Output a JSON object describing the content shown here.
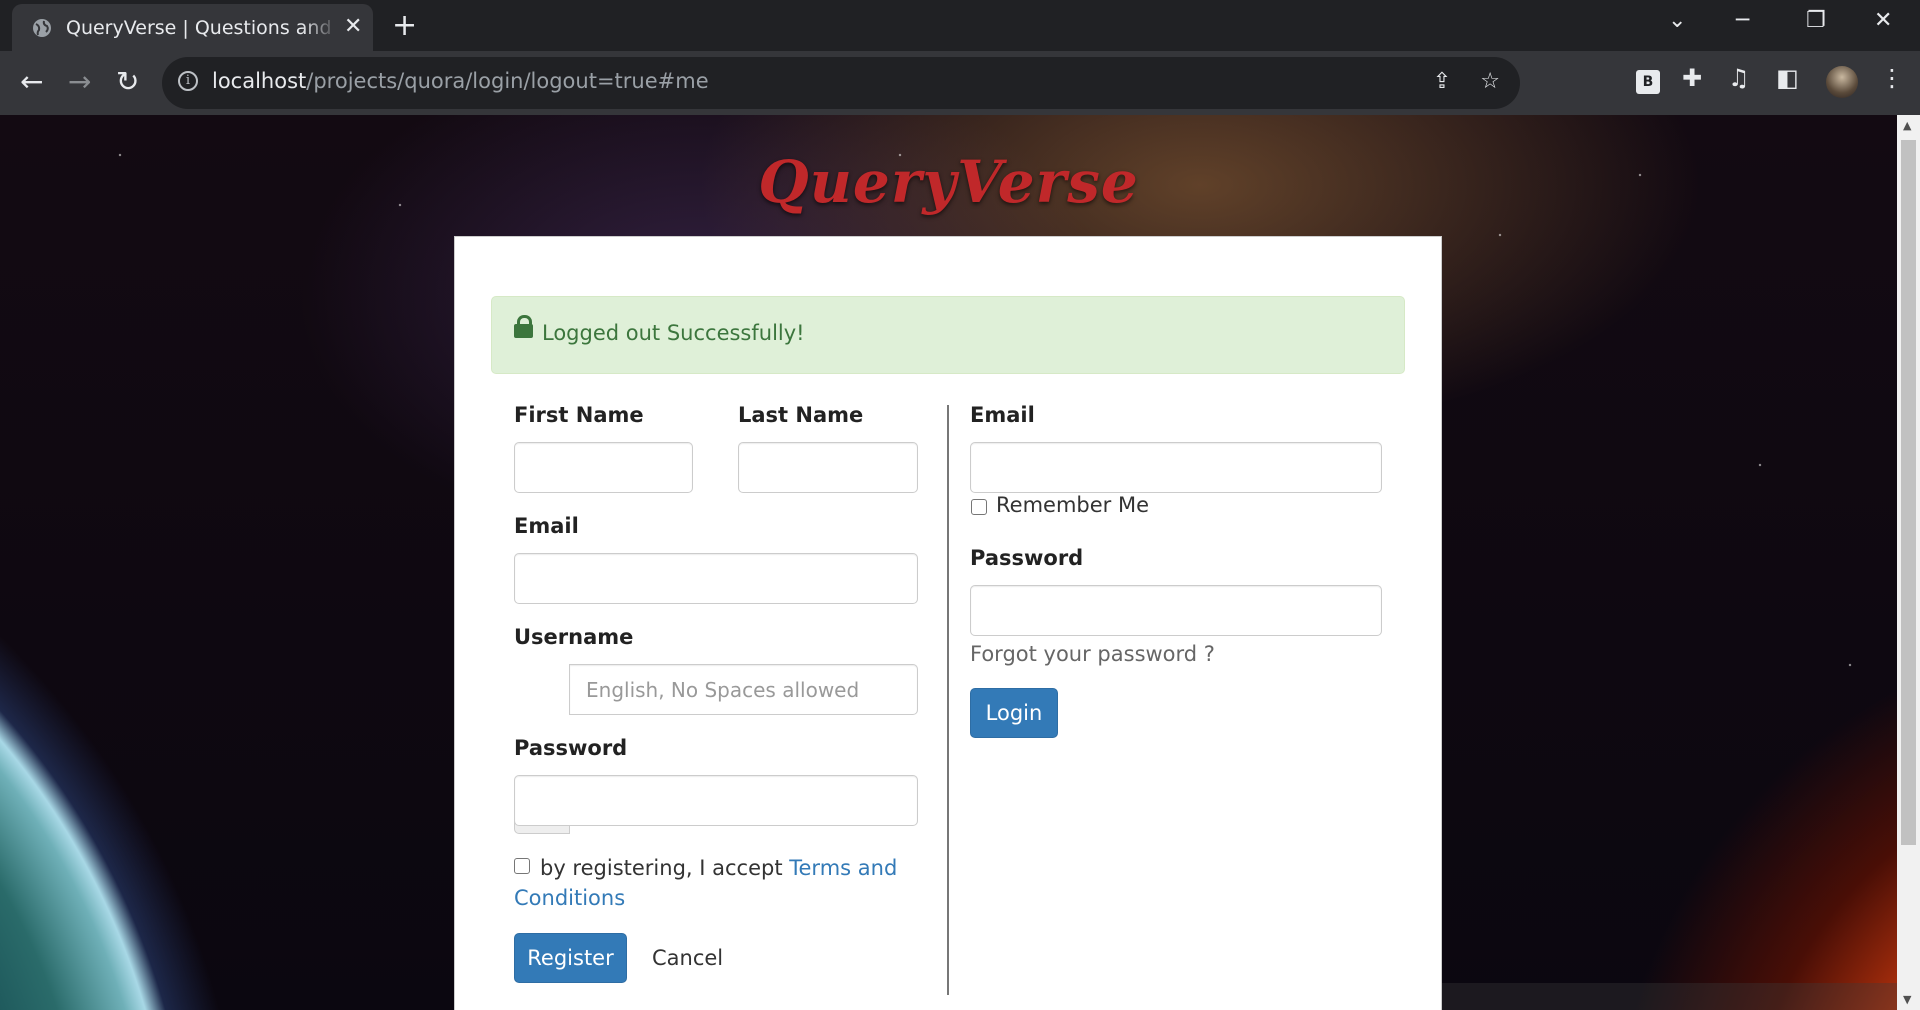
{
  "browser": {
    "tab_title": "QueryVerse | Questions and Answers",
    "tab_close": "✕",
    "new_tab": "+",
    "url_host": "localhost",
    "url_path": "/projects/quora/login/logout=true#me",
    "icons": [
      "globe-icon",
      "back-icon",
      "forward-icon",
      "reload-icon",
      "info-icon",
      "share-icon",
      "star-icon",
      "bold-extension-icon",
      "puzzle-icon",
      "media-icon",
      "sidebar-icon",
      "profile-avatar",
      "menu-icon"
    ],
    "ext_b": "B"
  },
  "page": {
    "brand": "QueryVerse",
    "alert": "Logged out Successfully!",
    "register": {
      "first_name_label": "First Name",
      "last_name_label": "Last Name",
      "email_label": "Email",
      "username_label": "Username",
      "username_addon": "@",
      "username_placeholder": "English, No Spaces allowed",
      "password_label": "Password",
      "terms_prefix": "by registering, I accept",
      "terms_link": "Terms and Conditions",
      "register_button": "Register",
      "cancel_button": "Cancel"
    },
    "login": {
      "email_label": "Email",
      "remember_me": "Remember Me",
      "password_label": "Password",
      "forgot_link": "Forgot your password ?",
      "login_button": "Login"
    }
  },
  "colors": {
    "brand": "#c0282a",
    "alert_bg": "#dff0d8",
    "alert_text": "#3c763d",
    "primary": "#337ab7"
  }
}
